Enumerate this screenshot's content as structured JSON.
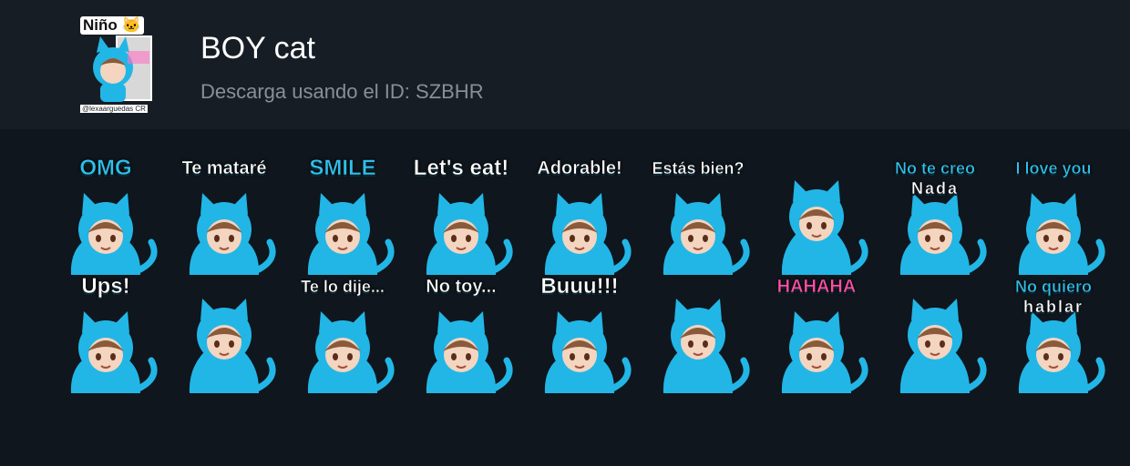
{
  "pack": {
    "icon_tag": "Niño 🐱",
    "icon_handle": "@lexaarguedas CR",
    "title": "BOY cat",
    "subtitle": "Descarga usando el ID: SZBHR"
  },
  "colors": {
    "header_bg": "#161d25",
    "page_bg": "#0f161d",
    "hood": "#22b6e6",
    "hair": "#8a5a3a"
  },
  "stickers": [
    {
      "caption": "OMG",
      "style": "blue big"
    },
    {
      "caption": "Te mataré",
      "style": ""
    },
    {
      "caption": "SMILE",
      "style": "blue big"
    },
    {
      "caption": "Let's eat!",
      "style": "big"
    },
    {
      "caption": "Adorable!",
      "style": ""
    },
    {
      "caption": "Estás bien?",
      "style": "small"
    },
    {
      "caption": "",
      "style": ""
    },
    {
      "caption": "No te creo",
      "caption2": "Nada",
      "style": "blue small"
    },
    {
      "caption": "I love you",
      "style": "blue small"
    },
    {
      "caption": "Ups!",
      "style": "big"
    },
    {
      "caption": "",
      "style": ""
    },
    {
      "caption": "Te lo dije...",
      "style": "small"
    },
    {
      "caption": "No toy...",
      "style": ""
    },
    {
      "caption": "Buuu!!!",
      "style": "big"
    },
    {
      "caption": "",
      "style": ""
    },
    {
      "caption": "HAHAHA",
      "style": "pink"
    },
    {
      "caption": "",
      "style": ""
    },
    {
      "caption": "No quiero",
      "caption2": "hablar",
      "style": "blue small"
    }
  ]
}
